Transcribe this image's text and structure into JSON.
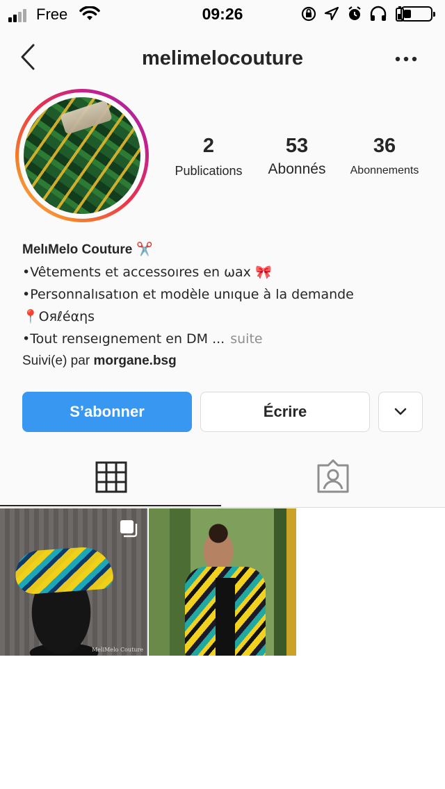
{
  "status_bar": {
    "carrier": "Free",
    "time": "09:26"
  },
  "header": {
    "username": "melimelocouture"
  },
  "stats": [
    {
      "value": "2",
      "label": "Publications"
    },
    {
      "value": "53",
      "label": "Abonnés"
    },
    {
      "value": "36",
      "label": "Abonnements"
    }
  ],
  "bio": {
    "name": "MelıMelo Couture",
    "name_emoji": "✂️",
    "line1": "•Vêtements et accessoıres en ωax",
    "line1_emoji": "🎀",
    "line2": "•Personnalısatıon et modèle unıque à la demande",
    "line3_emoji": "📍",
    "line3": "Oяℓéαηѕ",
    "line4": "•Tout renseıgnement en DM ...",
    "more_label": "suite",
    "followed_prefix": "Suivi(e) par",
    "followed_by": "morgane.bsg"
  },
  "buttons": {
    "follow": "S’abonner",
    "message": "Écrire"
  },
  "posts": [
    {
      "watermark": "MeliMelo Couture"
    }
  ],
  "colors": {
    "accent": "#3897f0",
    "text": "#262626",
    "muted": "#8e8e8e",
    "border": "#dbdbdb"
  }
}
